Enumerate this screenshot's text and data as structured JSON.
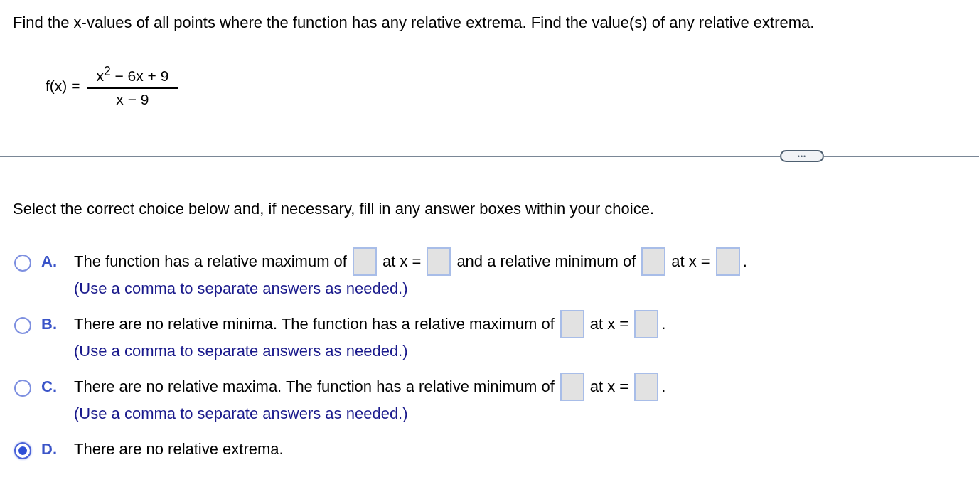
{
  "question": "Find the x-values of all points where the function has any relative extrema. Find the value(s) of any relative extrema.",
  "formula": {
    "lhs": "f(x) =",
    "numerator": "x$^{2}$ − 6x + 9",
    "denominator": "x − 9"
  },
  "more_button": "•••",
  "instruction": "Select the correct choice below and, if necessary, fill in any answer boxes within your choice.",
  "choices": [
    {
      "letter": "A.",
      "selected": false,
      "parts": [
        {
          "kind": "text",
          "text": "The function has a relative maximum of"
        },
        {
          "kind": "box"
        },
        {
          "kind": "text",
          "text": "at x ="
        },
        {
          "kind": "box"
        },
        {
          "kind": "text",
          "text": "and a relative minimum of"
        },
        {
          "kind": "box"
        },
        {
          "kind": "text",
          "text": "at x ="
        },
        {
          "kind": "box"
        },
        {
          "kind": "text",
          "text": "."
        }
      ],
      "hint": "(Use a comma to separate answers as needed.)"
    },
    {
      "letter": "B.",
      "selected": false,
      "parts": [
        {
          "kind": "text",
          "text": "There are no relative minima. The function has a relative maximum of"
        },
        {
          "kind": "box"
        },
        {
          "kind": "text",
          "text": "at x ="
        },
        {
          "kind": "box"
        },
        {
          "kind": "text",
          "text": "."
        }
      ],
      "hint": "(Use a comma to separate answers as needed.)"
    },
    {
      "letter": "C.",
      "selected": false,
      "parts": [
        {
          "kind": "text",
          "text": "There are no relative maxima. The function has a relative minimum of"
        },
        {
          "kind": "box"
        },
        {
          "kind": "text",
          "text": "at x ="
        },
        {
          "kind": "box"
        },
        {
          "kind": "text",
          "text": "."
        }
      ],
      "hint": "(Use a comma to separate answers as needed.)"
    },
    {
      "letter": "D.",
      "selected": true,
      "parts": [
        {
          "kind": "text",
          "text": "There are no relative extrema."
        }
      ]
    }
  ]
}
